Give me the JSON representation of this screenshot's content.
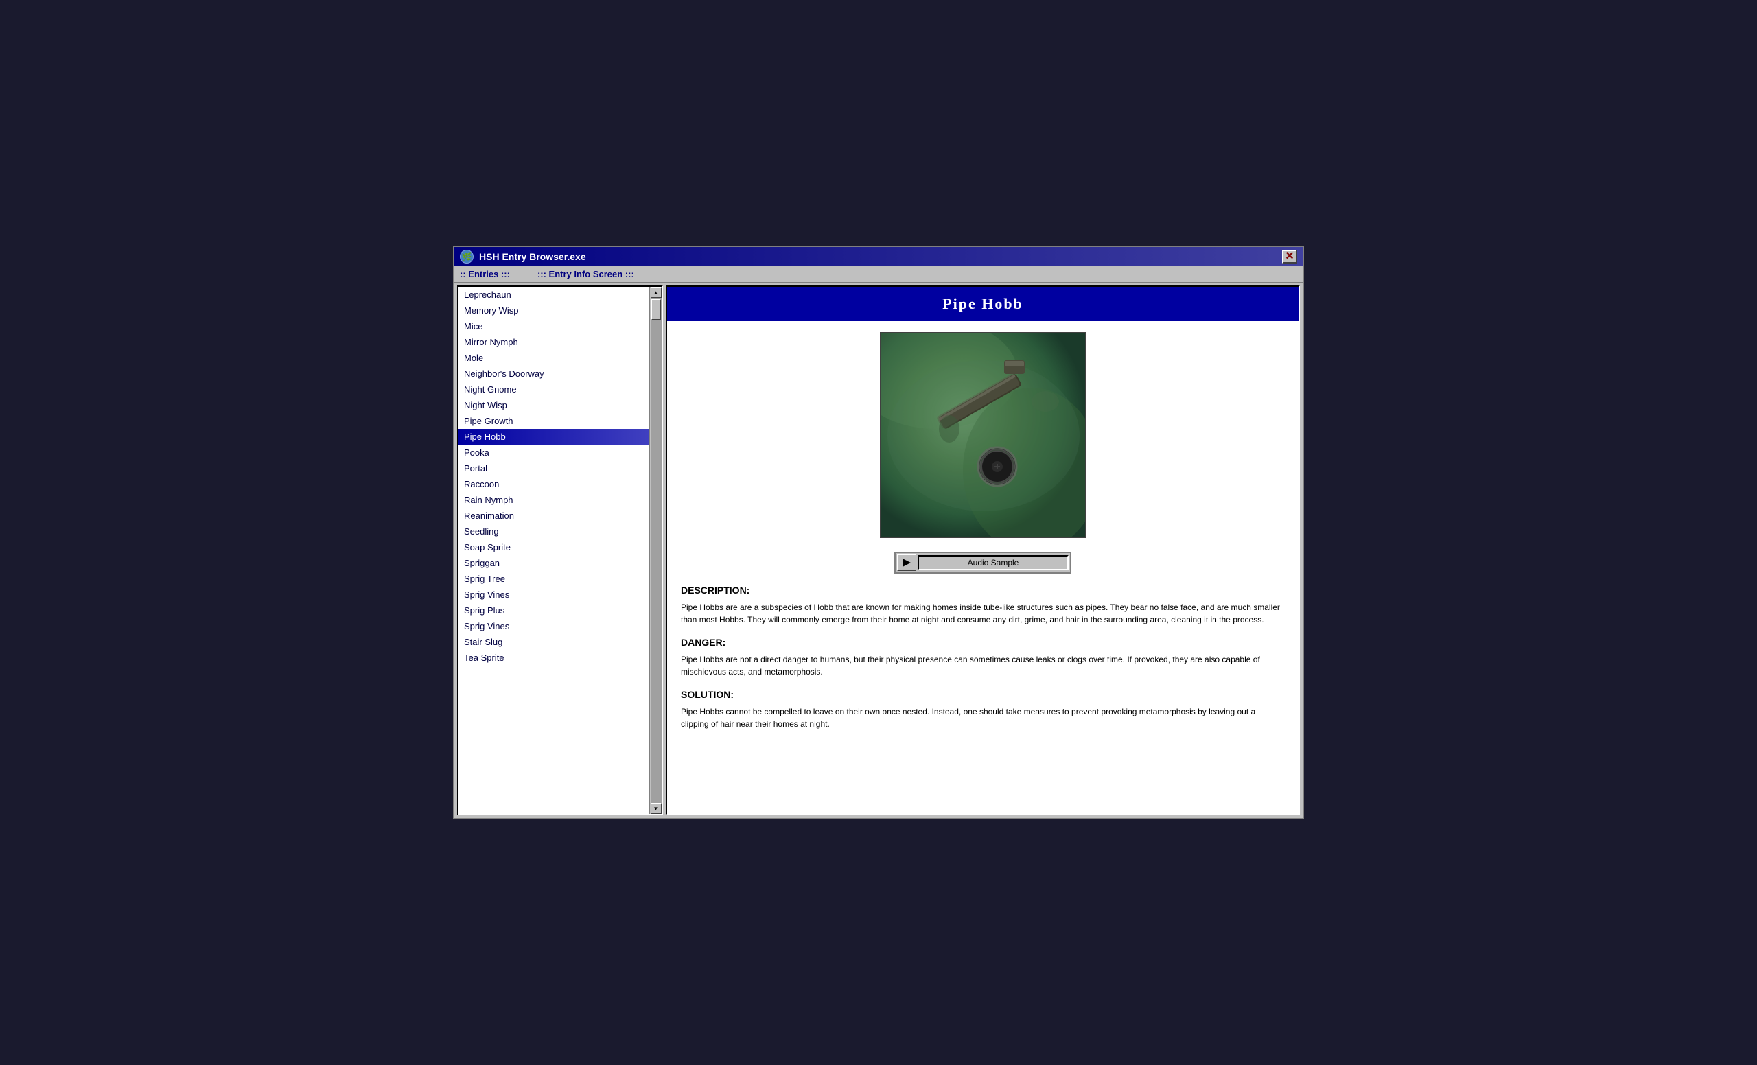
{
  "window": {
    "title": "HSH Entry Browser.exe",
    "close_label": "✕"
  },
  "header": {
    "entries_label": ":: Entries :::",
    "info_label": "::: Entry Info Screen :::"
  },
  "entries_list": [
    {
      "id": "leprechaun",
      "label": "Leprechaun",
      "selected": false
    },
    {
      "id": "memory-wisp",
      "label": "Memory Wisp",
      "selected": false
    },
    {
      "id": "mice",
      "label": "Mice",
      "selected": false
    },
    {
      "id": "mirror-nymph",
      "label": "Mirror Nymph",
      "selected": false
    },
    {
      "id": "mole",
      "label": "Mole",
      "selected": false
    },
    {
      "id": "neighbors-doorway",
      "label": "Neighbor's Doorway",
      "selected": false
    },
    {
      "id": "night-gnome",
      "label": "Night Gnome",
      "selected": false
    },
    {
      "id": "night-wisp",
      "label": "Night Wisp",
      "selected": false
    },
    {
      "id": "pipe-growth",
      "label": "Pipe Growth",
      "selected": false
    },
    {
      "id": "pipe-hobb",
      "label": "Pipe Hobb",
      "selected": true
    },
    {
      "id": "pooka",
      "label": "Pooka",
      "selected": false
    },
    {
      "id": "portal",
      "label": "Portal",
      "selected": false
    },
    {
      "id": "raccoon",
      "label": "Raccoon",
      "selected": false
    },
    {
      "id": "rain-nymph",
      "label": "Rain Nymph",
      "selected": false
    },
    {
      "id": "reanimation",
      "label": "Reanimation",
      "selected": false
    },
    {
      "id": "seedling",
      "label": "Seedling",
      "selected": false
    },
    {
      "id": "soap-sprite",
      "label": "Soap Sprite",
      "selected": false
    },
    {
      "id": "spriggan",
      "label": "Spriggan",
      "selected": false
    },
    {
      "id": "sprig-tree",
      "label": "Sprig Tree",
      "selected": false
    },
    {
      "id": "sprig-vines",
      "label": "Sprig Vines",
      "selected": false
    },
    {
      "id": "sprig-plus",
      "label": "Sprig Plus",
      "selected": false
    },
    {
      "id": "sprig-vines-2",
      "label": "Sprig Vines",
      "selected": false
    },
    {
      "id": "stair-slug",
      "label": "Stair Slug",
      "selected": false
    },
    {
      "id": "tea-sprite",
      "label": "Tea Sprite",
      "selected": false
    }
  ],
  "entry": {
    "title": "Pipe Hobb",
    "audio_label": "Audio Sample",
    "play_label": "▶",
    "description_label": "DESCRIPTION:",
    "description_text": "Pipe Hobbs are are a subspecies of Hobb that are known for making homes inside tube-like structures such as pipes. They bear no false face, and are much smaller than most Hobbs. They will commonly emerge from their home at night and consume any dirt, grime, and hair in the surrounding area, cleaning it in the process.",
    "danger_label": "DANGER:",
    "danger_text": "Pipe Hobbs are not a direct danger to humans, but their physical presence can sometimes cause leaks or clogs over time. If provoked, they are also capable of mischievous acts, and metamorphosis.",
    "solution_label": "SOLUTION:",
    "solution_text": "Pipe Hobbs cannot be compelled to leave on their own once nested. Instead, one should take measures to prevent provoking metamorphosis by leaving out a clipping of hair near their homes at night."
  },
  "scroll": {
    "up_arrow": "▲",
    "down_arrow": "▼"
  }
}
